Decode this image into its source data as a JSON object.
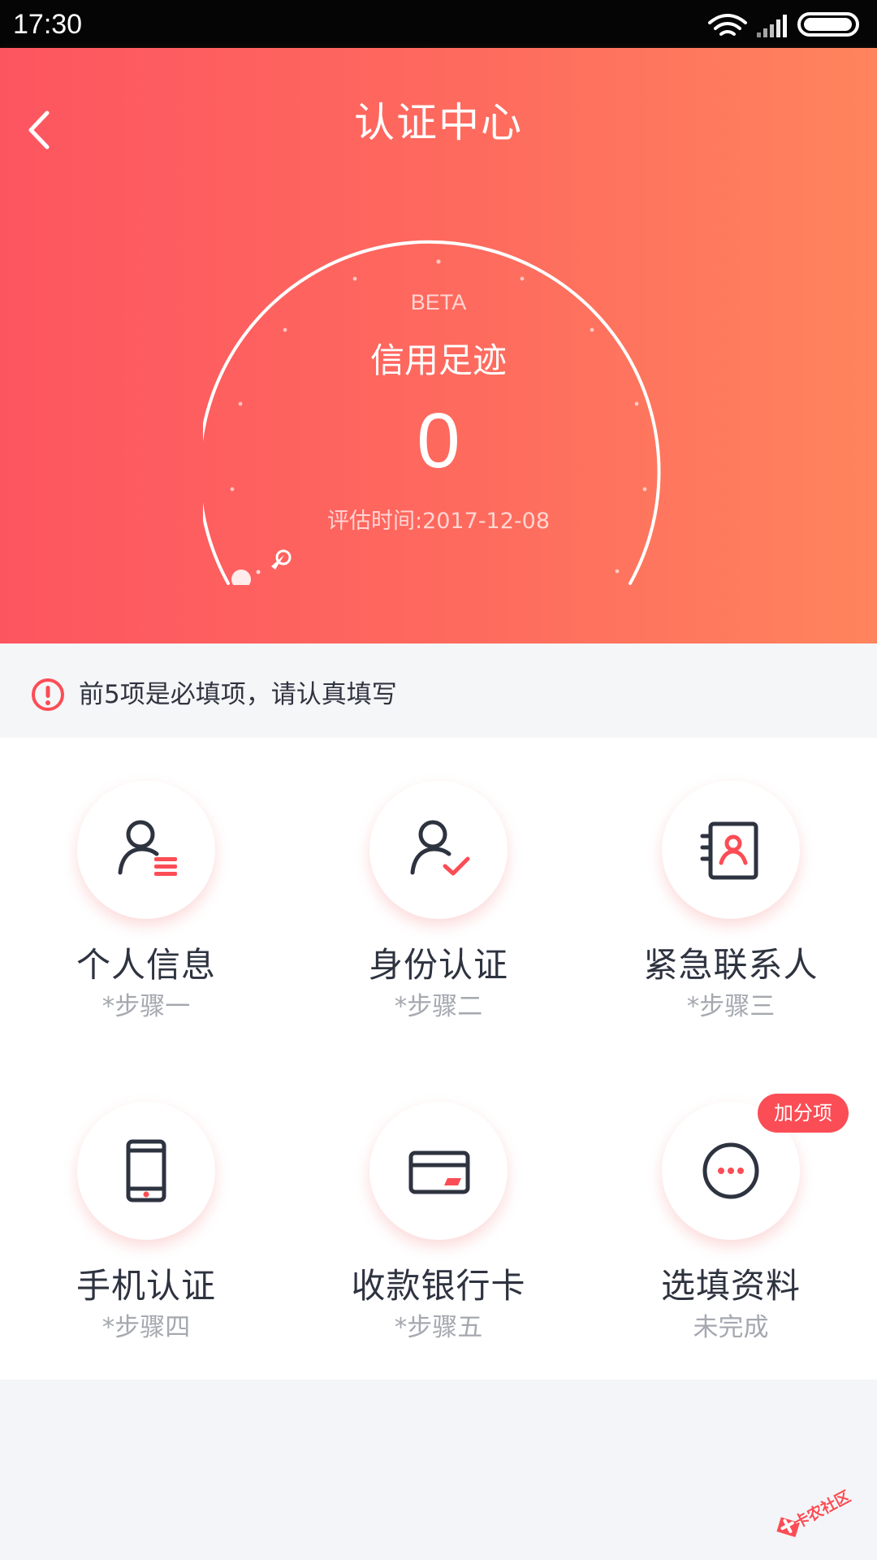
{
  "status_bar": {
    "time": "17:30"
  },
  "header": {
    "title": "认证中心",
    "back_icon": "chevron-left-icon"
  },
  "gauge": {
    "beta_label": "BETA",
    "title": "信用足迹",
    "score": "0",
    "date_label": "评估时间:2017-12-08"
  },
  "notice": {
    "icon": "alert-circle-icon",
    "text": "前5项是必填项，请认真填写"
  },
  "items": [
    {
      "title": "个人信息",
      "step": "*步骤一",
      "icon": "user-list-icon"
    },
    {
      "title": "身份认证",
      "step": "*步骤二",
      "icon": "user-check-icon"
    },
    {
      "title": "紧急联系人",
      "step": "*步骤三",
      "icon": "contact-book-icon"
    },
    {
      "title": "手机认证",
      "step": "*步骤四",
      "icon": "phone-icon"
    },
    {
      "title": "收款银行卡",
      "step": "*步骤五",
      "icon": "bank-card-icon"
    },
    {
      "title": "选填资料",
      "step": "未完成",
      "icon": "more-dots-icon",
      "badge": "加分项"
    }
  ],
  "watermark": {
    "text": "卡农社区"
  },
  "colors": {
    "accent": "#FB4D55",
    "header_gradient_start": "#FD5560",
    "header_gradient_end": "#FF845D",
    "text_primary": "#2E3340",
    "text_secondary": "#A5A8AF",
    "background": "#F3F5F8"
  }
}
